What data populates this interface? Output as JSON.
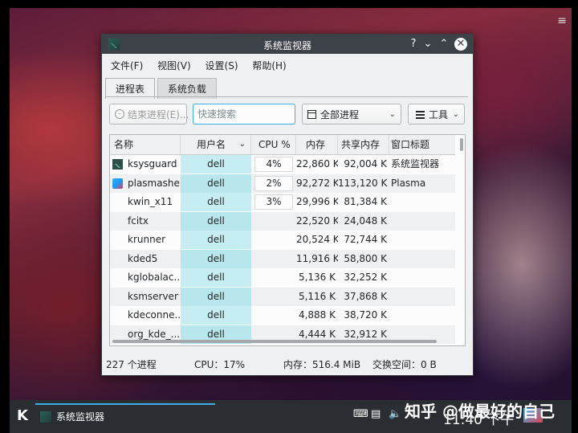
{
  "window": {
    "title": "系统监视器",
    "help_btn": "?",
    "min_btn": "⌄",
    "max_btn": "⌃",
    "close_btn": "✕"
  },
  "menu": {
    "file": "文件(F)",
    "view": "视图(V)",
    "settings": "设置(S)",
    "help": "帮助(H)"
  },
  "tabs": {
    "processes": "进程表",
    "system_load": "系统负载"
  },
  "toolbar": {
    "end_process": "结束进程(E)...",
    "search_placeholder": "快速搜索",
    "filter_selected": "全部进程",
    "tools": "工具"
  },
  "table": {
    "headers": {
      "name": "名称",
      "user": "用户名",
      "cpu": "CPU %",
      "memory": "内存",
      "shared": "共享内存",
      "window_title": "窗口标题"
    },
    "rows": [
      {
        "name": "ksysguard",
        "user": "dell",
        "cpu": "4%",
        "memory": "22,860 K",
        "shared": "92,004 K",
        "title": "系统监视器",
        "icon": "ksysguard-icon"
      },
      {
        "name": "plasmashell",
        "user": "dell",
        "cpu": "2%",
        "memory": "92,272 K",
        "shared": "113,120 K",
        "title": "Plasma",
        "icon": "plasma-icon"
      },
      {
        "name": "kwin_x11",
        "user": "dell",
        "cpu": "3%",
        "memory": "29,996 K",
        "shared": "81,384 K",
        "title": "",
        "icon": ""
      },
      {
        "name": "fcitx",
        "user": "dell",
        "cpu": "",
        "memory": "22,520 K",
        "shared": "24,048 K",
        "title": "",
        "icon": ""
      },
      {
        "name": "krunner",
        "user": "dell",
        "cpu": "",
        "memory": "20,524 K",
        "shared": "72,744 K",
        "title": "",
        "icon": ""
      },
      {
        "name": "kded5",
        "user": "dell",
        "cpu": "",
        "memory": "11,916 K",
        "shared": "58,800 K",
        "title": "",
        "icon": ""
      },
      {
        "name": "kglobalac...",
        "user": "dell",
        "cpu": "",
        "memory": "5,136 K",
        "shared": "32,252 K",
        "title": "",
        "icon": ""
      },
      {
        "name": "ksmserver",
        "user": "dell",
        "cpu": "",
        "memory": "5,116 K",
        "shared": "37,868 K",
        "title": "",
        "icon": ""
      },
      {
        "name": "kdeconne...",
        "user": "dell",
        "cpu": "",
        "memory": "4,888 K",
        "shared": "38,720 K",
        "title": "",
        "icon": ""
      },
      {
        "name": "org_kde_...",
        "user": "dell",
        "cpu": "",
        "memory": "4,444 K",
        "shared": "32,912 K",
        "title": "",
        "icon": ""
      }
    ]
  },
  "status": {
    "processes": "227 个进程",
    "cpu": "CPU：17%",
    "memory": "内存：516.4 MiB",
    "swap": "交换空间：0 B"
  },
  "taskbar": {
    "task_label": "系统监视器",
    "clock": "11:40 下午",
    "watermark": "知乎 @做最好的自己"
  },
  "colors": {
    "accent": "#3daee9",
    "titlebar": "#3d4148",
    "user_column": "#c6eef2",
    "taskbar": "#2a2e32"
  }
}
